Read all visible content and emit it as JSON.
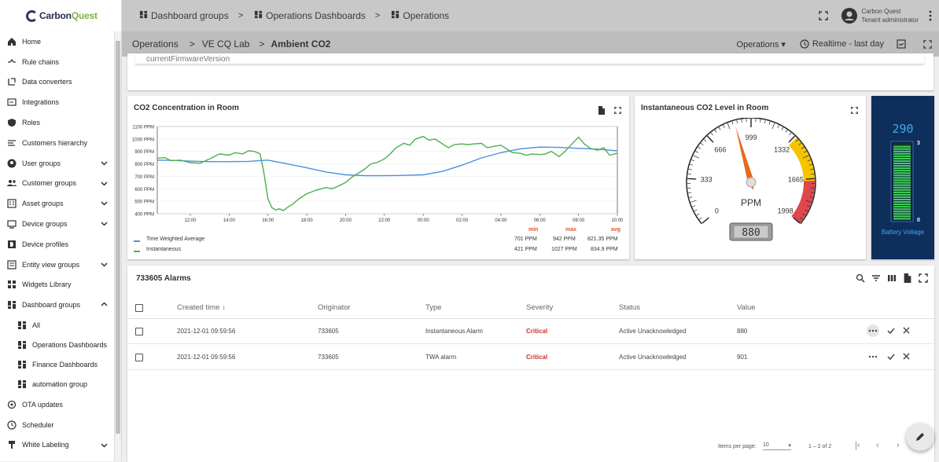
{
  "app": {
    "logo_a": "Carbon",
    "logo_b": "Quest"
  },
  "sidebar": {
    "items": [
      {
        "label": "Home",
        "icon": "home-icon"
      },
      {
        "label": "Rule chains",
        "icon": "rule-chains-icon"
      },
      {
        "label": "Data converters",
        "icon": "data-converters-icon"
      },
      {
        "label": "Integrations",
        "icon": "integrations-icon"
      },
      {
        "label": "Roles",
        "icon": "roles-icon"
      },
      {
        "label": "Customers hierarchy",
        "icon": "customers-hierarchy-icon"
      },
      {
        "label": "User groups",
        "icon": "user-groups-icon"
      },
      {
        "label": "Customer groups",
        "icon": "customer-groups-icon"
      },
      {
        "label": "Asset groups",
        "icon": "asset-groups-icon"
      },
      {
        "label": "Device groups",
        "icon": "device-groups-icon"
      },
      {
        "label": "Device profiles",
        "icon": "device-profiles-icon"
      },
      {
        "label": "Entity view groups",
        "icon": "entity-view-groups-icon"
      },
      {
        "label": "Widgets Library",
        "icon": "widgets-library-icon"
      },
      {
        "label": "Dashboard groups",
        "icon": "dashboard-groups-icon"
      }
    ],
    "sub_items": [
      {
        "label": "All"
      },
      {
        "label": "Operations Dashboards"
      },
      {
        "label": "Finance Dashboards"
      },
      {
        "label": "automation group"
      }
    ],
    "bottom_items": [
      {
        "label": "OTA updates",
        "icon": "ota-updates-icon"
      },
      {
        "label": "Scheduler",
        "icon": "scheduler-icon"
      },
      {
        "label": "White Labeling",
        "icon": "white-labeling-icon"
      }
    ]
  },
  "header": {
    "crumbs": [
      "Dashboard groups",
      "Operations Dashboards",
      "Operations"
    ],
    "user_name": "Carbon Quest",
    "user_role": "Tenant administrator"
  },
  "subheader": {
    "crumbs": [
      "Operations",
      "VE CQ Lab",
      "Ambient CO2"
    ],
    "state_label": "Operations",
    "timewindow": "Realtime - last day"
  },
  "top_card": {
    "text": "currentFirmwareVersion"
  },
  "chart_card": {
    "title": "CO2 Concentration in Room",
    "stat_headers": {
      "min": "min",
      "max": "max",
      "avg": "avg"
    },
    "legend": [
      {
        "name": "Time Weighted Average",
        "color": "#4a90e2",
        "min": "701 PPM",
        "max": "942 PPM",
        "avg": "821.35 PPM"
      },
      {
        "name": "Instantaneous",
        "color": "#4caf50",
        "min": "421 PPM",
        "max": "1027 PPM",
        "avg": "834.9 PPM"
      }
    ]
  },
  "chart_data": {
    "type": "line",
    "y_ticks": [
      "1100 PPM",
      "1000 PPM",
      "900 PPM",
      "800 PPM",
      "700 PPM",
      "600 PPM",
      "500 PPM",
      "400 PPM"
    ],
    "x_ticks": [
      "12:00",
      "14:00",
      "16:00",
      "18:00",
      "20:00",
      "22:00",
      "00:00",
      "02:00",
      "04:00",
      "06:00",
      "08:00",
      "10:00"
    ],
    "ylim": [
      400,
      1100
    ],
    "xlim": [
      10.3,
      34.0
    ],
    "series": [
      {
        "name": "Time Weighted Average",
        "color": "#4a90e2",
        "x": [
          10.3,
          11,
          12,
          13,
          14,
          15,
          15.5,
          16,
          17,
          18,
          19,
          20,
          21,
          22,
          23,
          24,
          25,
          26,
          27,
          28,
          29,
          30,
          31,
          32,
          33,
          34
        ],
        "y": [
          830,
          828,
          822,
          818,
          818,
          820,
          825,
          830,
          800,
          768,
          735,
          712,
          705,
          705,
          708,
          712,
          740,
          790,
          848,
          890,
          920,
          935,
          932,
          925,
          918,
          905
        ]
      },
      {
        "name": "Instantaneous",
        "color": "#4caf50",
        "x": [
          10.3,
          10.7,
          11,
          11.5,
          12,
          12.5,
          13,
          13.5,
          14,
          14.3,
          14.7,
          15,
          15.3,
          15.6,
          15.8,
          16,
          16.2,
          16.4,
          16.6,
          16.8,
          17,
          17.3,
          17.6,
          18,
          18.5,
          19,
          19.3,
          19.6,
          20,
          20.3,
          20.6,
          21,
          21.3,
          21.6,
          22,
          22.3,
          22.6,
          23,
          23.3,
          23.6,
          24,
          24.3,
          24.6,
          25,
          25.3,
          25.6,
          26,
          26.3,
          26.6,
          27,
          27.3,
          27.6,
          28,
          28.3,
          28.6,
          29,
          29.3,
          29.6,
          30,
          30.3,
          30.6,
          31,
          31.3,
          31.6,
          32,
          32.3,
          32.6,
          33,
          33.3,
          33.6,
          34
        ],
        "y": [
          845,
          850,
          825,
          830,
          810,
          805,
          840,
          880,
          870,
          890,
          880,
          905,
          900,
          880,
          720,
          520,
          450,
          430,
          440,
          425,
          450,
          480,
          520,
          560,
          590,
          610,
          600,
          620,
          650,
          690,
          720,
          760,
          800,
          810,
          840,
          880,
          930,
          965,
          950,
          1000,
          1020,
          990,
          1000,
          960,
          930,
          955,
          960,
          955,
          960,
          965,
          930,
          940,
          950,
          920,
          890,
          885,
          870,
          880,
          875,
          880,
          900,
          860,
          900,
          950,
          1015,
          960,
          925,
          910,
          930,
          870,
          885
        ]
      }
    ]
  },
  "gauge_card": {
    "title": "Instantaneous CO2 Level in Room",
    "ticks": [
      "0",
      "333",
      "666",
      "999",
      "1332",
      "1665",
      "1998"
    ],
    "unit": "PPM",
    "value": "880",
    "value_num": 880,
    "max": 1998,
    "needle_color": "#e66a1e"
  },
  "battery_card": {
    "value": "290",
    "top_tick": "3",
    "bottom_tick": "0",
    "label": "Battery Voltage",
    "level": 0.95
  },
  "alarms": {
    "title": "733605 Alarms",
    "columns": [
      "Created time",
      "Originator",
      "Type",
      "Severity",
      "Status",
      "Value"
    ],
    "rows": [
      {
        "created": "2021-12-01 09:59:56",
        "originator": "733605",
        "type": "Instantaneous Alarm",
        "severity": "Critical",
        "status": "Active Unacknowledged",
        "value": "880"
      },
      {
        "created": "2021-12-01 09:59:56",
        "originator": "733605",
        "type": "TWA alarm",
        "severity": "Critical",
        "status": "Active Unacknowledged",
        "value": "901"
      }
    ],
    "items_per_page_label": "Items per page:",
    "items_per_page": "10",
    "range": "1 – 2 of 2"
  }
}
